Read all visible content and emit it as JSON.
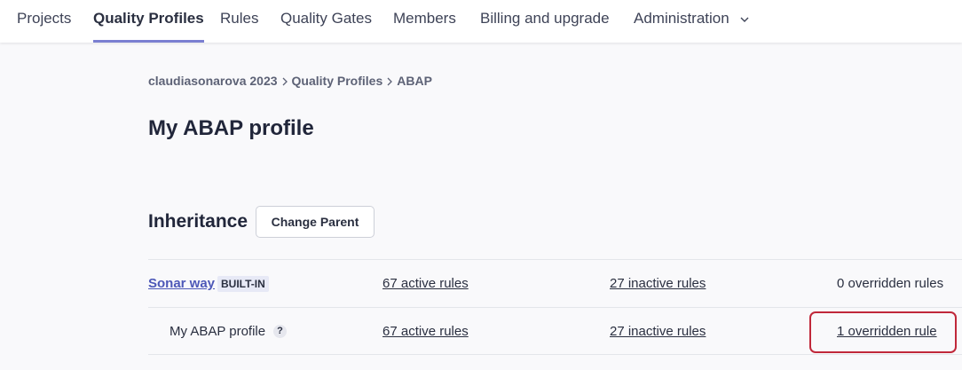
{
  "nav": {
    "items": [
      {
        "label": "Projects"
      },
      {
        "label": "Quality Profiles",
        "active": true
      },
      {
        "label": "Rules"
      },
      {
        "label": "Quality Gates"
      },
      {
        "label": "Members"
      },
      {
        "label": "Billing and upgrade"
      },
      {
        "label": "Administration",
        "icon": "chevron-down-icon"
      }
    ]
  },
  "breadcrumb": [
    "claudiasonarova 2023",
    "Quality Profiles",
    "ABAP"
  ],
  "page_title": "My ABAP profile",
  "inheritance": {
    "title": "Inheritance",
    "change_parent_label": "Change Parent",
    "rows": [
      {
        "name": "Sonar way",
        "badge": "BUILT-IN",
        "active_rules": "67 active rules",
        "inactive_rules": "27 inactive rules",
        "overridden_rules": "0 overridden rules"
      },
      {
        "name": "My ABAP profile",
        "help": "?",
        "active_rules": "67 active rules",
        "inactive_rules": "27 inactive rules",
        "overridden_rules": "1 overridden rule"
      }
    ]
  },
  "colors": {
    "accent_underline": "#7b7fd1",
    "profile_link": "#4d58b8",
    "highlight_border": "#c0283a"
  }
}
